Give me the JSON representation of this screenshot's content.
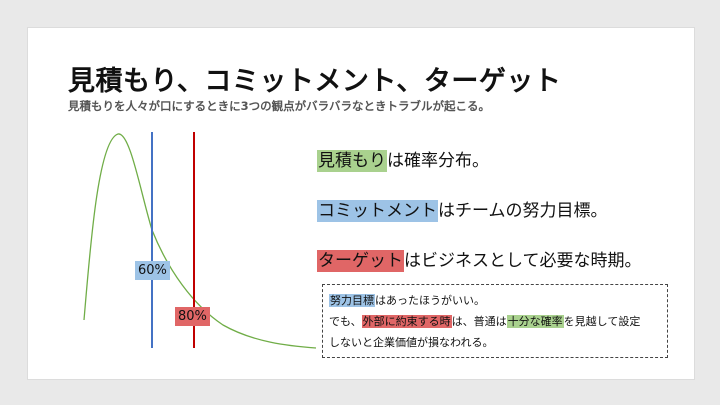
{
  "colors": {
    "curve": "#70ad47",
    "blue_line": "#4472c4",
    "red_line": "#c00000",
    "blue_highlight": "#9dc3e6",
    "red_highlight": "#e06666",
    "green_highlight": "#a9d18e",
    "label_blue_bg": "#9dc3e6",
    "label_red_bg": "#e06666"
  },
  "slide": {
    "title": "見積もり、コミットメント、ターゲット",
    "subtitle": "見積もりを人々が口にするときに3つの観点がバラバラなときトラブルが起こる。"
  },
  "chart": {
    "percentile_labels": [
      "60%",
      "80%"
    ]
  },
  "statements": [
    {
      "highlight": "見積もり",
      "rest": "は確率分布。",
      "color": "green"
    },
    {
      "highlight": "コミットメント",
      "rest": "はチームの努力目標。",
      "color": "blue"
    },
    {
      "highlight": "ターゲット",
      "rest": "はビジネスとして必要な時期。",
      "color": "red"
    }
  ],
  "note": {
    "line1_hl": "努力目標",
    "line1_rest": "はあったほうがいい。",
    "line2_a": "でも、",
    "line2_hl1": "外部に約束する時",
    "line2_b": "は、普通は",
    "line2_hl2": "十分な確率",
    "line2_c": "を見越して設定",
    "line3": "しないと企業価値が損なわれる。"
  }
}
